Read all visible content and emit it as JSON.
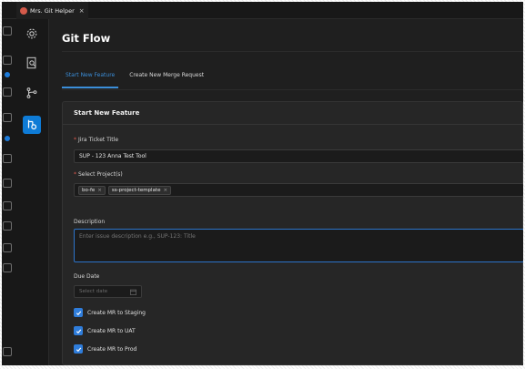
{
  "tab": {
    "title": "Mrs. Git Helper",
    "close": "×"
  },
  "header": {
    "title": "Git Flow"
  },
  "tabs": [
    {
      "label": "Start New Feature",
      "active": true
    },
    {
      "label": "Create New Merge Request",
      "active": false
    }
  ],
  "card": {
    "title": "Start New Feature",
    "jira": {
      "required_mark": "*",
      "label": "Jira Ticket Title",
      "value": "SUP - 123 Anna Test Tool"
    },
    "projects": {
      "required_mark": "*",
      "label": "Select Project(s)",
      "tags": [
        {
          "label": "bo-fe",
          "remove": "×"
        },
        {
          "label": "ss-project-template",
          "remove": "×"
        }
      ]
    },
    "description": {
      "label": "Description",
      "placeholder": "Enter issue description e.g., SUP-123: Title"
    },
    "due_date": {
      "label": "Due Date",
      "placeholder": "Select date"
    },
    "checkboxes": [
      {
        "label": "Create MR to Staging",
        "checked": true
      },
      {
        "label": "Create MR to UAT",
        "checked": true
      },
      {
        "label": "Create MR to Prod",
        "checked": true
      }
    ]
  },
  "colors": {
    "accent": "#2f7ddb",
    "active_tab": "#3b8ed9",
    "required": "#e05a4f",
    "background": "#1f1f1f"
  },
  "icons": {
    "sidebar": [
      "gear-icon",
      "document-search-icon",
      "git-branch-icon",
      "git-flow-icon"
    ]
  }
}
